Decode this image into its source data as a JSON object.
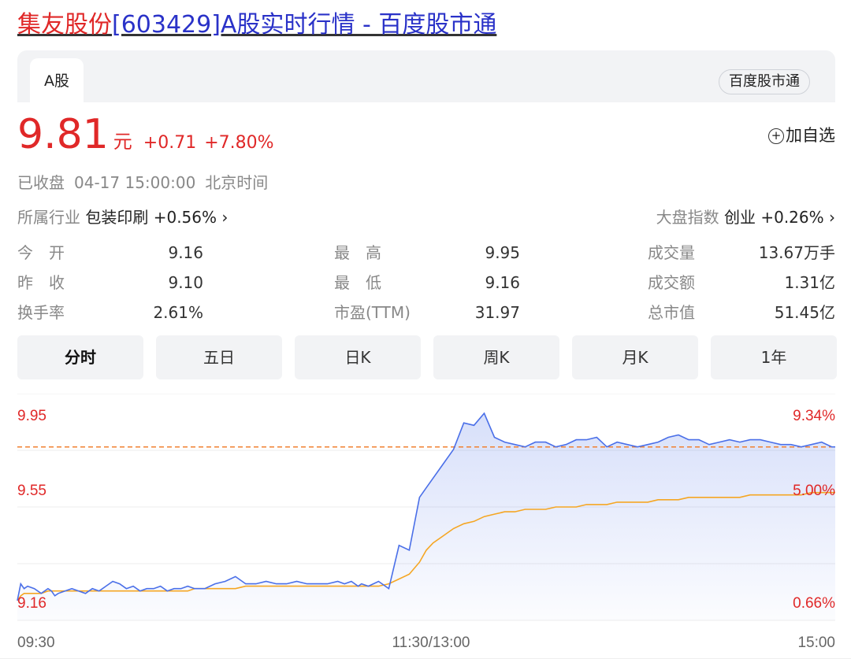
{
  "header": {
    "stock_name": "集友股份",
    "title_rest": "[603429]A股实时行情 - 百度股市通"
  },
  "tabs": {
    "active": "A股",
    "brand": "百度股市通"
  },
  "quote": {
    "price": "9.81",
    "unit": "元",
    "change": "+0.71",
    "change_pct": "+7.80%",
    "add_watch": "加自选"
  },
  "status": {
    "state": "已收盘",
    "time": "04-17 15:00:00",
    "tz": "北京时间"
  },
  "industry": {
    "label": "所属行业",
    "name": "包装印刷",
    "change": "+0.56%"
  },
  "market_index": {
    "label": "大盘指数",
    "name": "创业",
    "change": "+0.26%"
  },
  "stats": [
    [
      {
        "label": "今　开",
        "value": "9.16",
        "color": "#e02828"
      },
      {
        "label": "最　高",
        "value": "9.95",
        "color": "#e02828"
      },
      {
        "label": "成交量",
        "value": "13.67万手",
        "color": "#222222"
      }
    ],
    [
      {
        "label": "昨　收",
        "value": "9.10",
        "color": "#222222"
      },
      {
        "label": "最　低",
        "value": "9.16",
        "color": "#e02828"
      },
      {
        "label": "成交额",
        "value": "1.31亿",
        "color": "#222222"
      }
    ],
    [
      {
        "label": "换手率",
        "value": "2.61%",
        "color": "#222222"
      },
      {
        "label": "市盈(TTM)",
        "value": "31.97",
        "color": "#222222"
      },
      {
        "label": "总市值",
        "value": "51.45亿",
        "color": "#222222"
      }
    ]
  ],
  "periods": [
    "分时",
    "五日",
    "日K",
    "周K",
    "月K",
    "1年"
  ],
  "active_period": "分时",
  "colors": {
    "up": "#e02828",
    "price_line": "#4a6fe8",
    "avg_line": "#f5a623",
    "prev_close": "#f08030"
  },
  "chart_data": {
    "type": "line",
    "title": "",
    "y_left_ticks": [
      "9.95",
      "9.55",
      "9.16"
    ],
    "y_right_ticks": [
      "9.34%",
      "5.00%",
      "0.66%"
    ],
    "x_ticks": [
      "09:30",
      "11:30/13:00",
      "15:00"
    ],
    "ylim": [
      9.16,
      9.95
    ],
    "reference_price": 9.81,
    "x_minutes": [
      0,
      1,
      2,
      3,
      5,
      7,
      9,
      10,
      11,
      12,
      14,
      16,
      18,
      20,
      22,
      24,
      26,
      28,
      30,
      32,
      34,
      36,
      38,
      40,
      42,
      44,
      46,
      48,
      50,
      52,
      55,
      58,
      61,
      64,
      67,
      70,
      73,
      76,
      79,
      82,
      85,
      88,
      91,
      94,
      96,
      98,
      100,
      101,
      103,
      106,
      109,
      112,
      115,
      118,
      120,
      122,
      125,
      128,
      131,
      134,
      137,
      140,
      143,
      146,
      149,
      152,
      155,
      158,
      161,
      164,
      167,
      170,
      173,
      176,
      179,
      182,
      185,
      188,
      191,
      194,
      197,
      200,
      203,
      206,
      209,
      212,
      215,
      218,
      221,
      224,
      227,
      230,
      233,
      236,
      239,
      240
    ],
    "price": [
      9.17,
      9.24,
      9.22,
      9.23,
      9.22,
      9.2,
      9.22,
      9.21,
      9.19,
      9.2,
      9.21,
      9.22,
      9.21,
      9.2,
      9.22,
      9.21,
      9.23,
      9.25,
      9.24,
      9.22,
      9.23,
      9.21,
      9.22,
      9.22,
      9.23,
      9.21,
      9.22,
      9.22,
      9.23,
      9.22,
      9.22,
      9.24,
      9.25,
      9.27,
      9.24,
      9.24,
      9.25,
      9.24,
      9.24,
      9.25,
      9.24,
      9.24,
      9.24,
      9.25,
      9.24,
      9.25,
      9.23,
      9.24,
      9.23,
      9.25,
      9.22,
      9.4,
      9.38,
      9.6,
      9.64,
      9.68,
      9.74,
      9.8,
      9.91,
      9.9,
      9.95,
      9.85,
      9.83,
      9.82,
      9.81,
      9.83,
      9.83,
      9.81,
      9.82,
      9.84,
      9.84,
      9.85,
      9.81,
      9.83,
      9.82,
      9.81,
      9.82,
      9.83,
      9.85,
      9.86,
      9.84,
      9.84,
      9.82,
      9.83,
      9.84,
      9.83,
      9.84,
      9.84,
      9.83,
      9.82,
      9.82,
      9.81,
      9.82,
      9.83,
      9.81,
      9.81
    ],
    "avg": [
      9.17,
      9.19,
      9.2,
      9.2,
      9.2,
      9.2,
      9.21,
      9.21,
      9.21,
      9.21,
      9.21,
      9.21,
      9.21,
      9.21,
      9.21,
      9.21,
      9.21,
      9.21,
      9.21,
      9.21,
      9.21,
      9.21,
      9.21,
      9.21,
      9.21,
      9.21,
      9.21,
      9.21,
      9.21,
      9.22,
      9.22,
      9.22,
      9.22,
      9.22,
      9.23,
      9.23,
      9.23,
      9.23,
      9.23,
      9.23,
      9.23,
      9.23,
      9.23,
      9.23,
      9.23,
      9.23,
      9.23,
      9.23,
      9.23,
      9.23,
      9.24,
      9.26,
      9.28,
      9.33,
      9.38,
      9.41,
      9.44,
      9.47,
      9.49,
      9.5,
      9.52,
      9.53,
      9.54,
      9.54,
      9.55,
      9.55,
      9.55,
      9.56,
      9.56,
      9.56,
      9.57,
      9.57,
      9.57,
      9.58,
      9.58,
      9.58,
      9.58,
      9.59,
      9.59,
      9.59,
      9.6,
      9.6,
      9.6,
      9.6,
      9.6,
      9.6,
      9.61,
      9.61,
      9.61,
      9.61,
      9.61,
      9.61,
      9.62,
      9.62,
      9.62,
      9.62
    ]
  }
}
